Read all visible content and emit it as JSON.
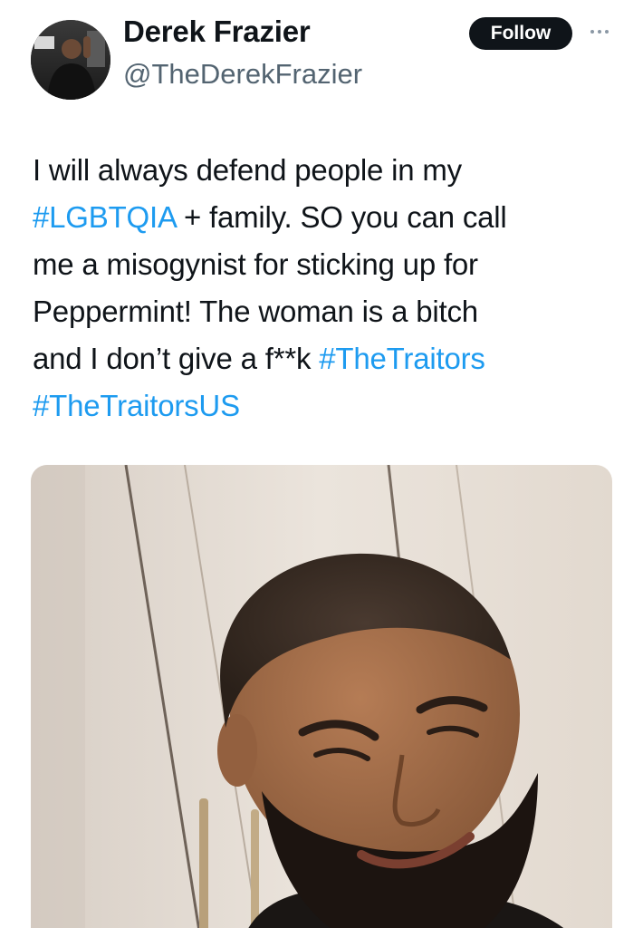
{
  "user": {
    "display_name": "Derek Frazier",
    "handle": "@TheDerekFrazier",
    "avatar_icon": "user-avatar-photo"
  },
  "actions": {
    "follow_label": "Follow",
    "more_icon": "more-dots-icon"
  },
  "tweet": {
    "line1": "I will always defend people in my",
    "hashtag_lgbtqia": "#LGBTQIA",
    "line2_rest": " + family. SO you can call",
    "line3": "me a misogynist for sticking up for",
    "line4": "Peppermint! The woman is a bitch",
    "line5_start": "and I don’t give a f**k ",
    "hashtag_traitors": "#TheTraitors",
    "hashtag_traitors_us": "#TheTraitorsUS"
  },
  "media": {
    "type": "photo"
  },
  "colors": {
    "link": "#1d9bf0",
    "text": "#0f1419",
    "secondary": "#536471",
    "follow_bg": "#0f1419"
  }
}
